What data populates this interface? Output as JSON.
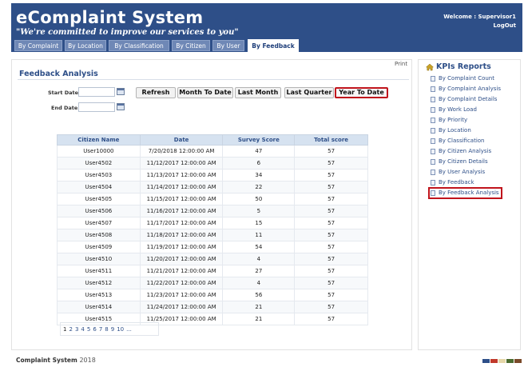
{
  "header": {
    "title": "eComplaint System",
    "tagline": "\"We're committed to improve our services to you\"",
    "welcome": "Welcome : Supervisor1",
    "logout": "LogOut"
  },
  "tabs": [
    {
      "label": "By Complaint"
    },
    {
      "label": "By Location"
    },
    {
      "label": "By Classification"
    },
    {
      "label": "By Citizen"
    },
    {
      "label": "By User"
    },
    {
      "label": "By Feedback",
      "active": true
    }
  ],
  "main": {
    "print": "Print",
    "section_title": "Feedback Analysis",
    "start_date_label": "Start Date :",
    "end_date_label": "End Date :",
    "start_date_value": "",
    "end_date_value": "",
    "buttons": {
      "refresh": "Refresh",
      "month_to_date": "Month To Date",
      "last_month": "Last Month",
      "last_quarter": "Last Quarter",
      "year_to_date": "Year To Date"
    },
    "table": {
      "columns": [
        "Citizen Name",
        "Date",
        "Survey Score",
        "Total score"
      ],
      "rows": [
        [
          "User10000",
          "7/20/2018 12:00:00 AM",
          "47",
          "57"
        ],
        [
          "User4502",
          "11/12/2017 12:00:00 AM",
          "6",
          "57"
        ],
        [
          "User4503",
          "11/13/2017 12:00:00 AM",
          "34",
          "57"
        ],
        [
          "User4504",
          "11/14/2017 12:00:00 AM",
          "22",
          "57"
        ],
        [
          "User4505",
          "11/15/2017 12:00:00 AM",
          "50",
          "57"
        ],
        [
          "User4506",
          "11/16/2017 12:00:00 AM",
          "5",
          "57"
        ],
        [
          "User4507",
          "11/17/2017 12:00:00 AM",
          "15",
          "57"
        ],
        [
          "User4508",
          "11/18/2017 12:00:00 AM",
          "11",
          "57"
        ],
        [
          "User4509",
          "11/19/2017 12:00:00 AM",
          "54",
          "57"
        ],
        [
          "User4510",
          "11/20/2017 12:00:00 AM",
          "4",
          "57"
        ],
        [
          "User4511",
          "11/21/2017 12:00:00 AM",
          "27",
          "57"
        ],
        [
          "User4512",
          "11/22/2017 12:00:00 AM",
          "4",
          "57"
        ],
        [
          "User4513",
          "11/23/2017 12:00:00 AM",
          "56",
          "57"
        ],
        [
          "User4514",
          "11/24/2017 12:00:00 AM",
          "21",
          "57"
        ],
        [
          "User4515",
          "11/25/2017 12:00:00 AM",
          "21",
          "57"
        ]
      ]
    },
    "pager": [
      "1",
      "2",
      "3",
      "4",
      "5",
      "6",
      "7",
      "8",
      "9",
      "10",
      "..."
    ]
  },
  "sidebar": {
    "title": "KPIs Reports",
    "items": [
      {
        "label": "By Complaint Count"
      },
      {
        "label": "By Complaint Analysis"
      },
      {
        "label": "By Complaint Details"
      },
      {
        "label": "By Work Load"
      },
      {
        "label": "By Priority"
      },
      {
        "label": "By Location"
      },
      {
        "label": "By Classification"
      },
      {
        "label": "By Citizen Analysis"
      },
      {
        "label": "By Citizen Details"
      },
      {
        "label": "By User Analysis"
      },
      {
        "label": "By Feedback"
      },
      {
        "label": "By Feedback Analysis",
        "highlighted": true
      }
    ]
  },
  "footer": {
    "text": "Complaint System",
    "year": "2018",
    "swatch_colors": [
      "#2e4f88",
      "#c0392b",
      "#e5d7a8",
      "#4a6b2e",
      "#7a4a2a"
    ]
  },
  "colors": {
    "brand": "#2e4f88",
    "highlight": "#c0141c"
  }
}
